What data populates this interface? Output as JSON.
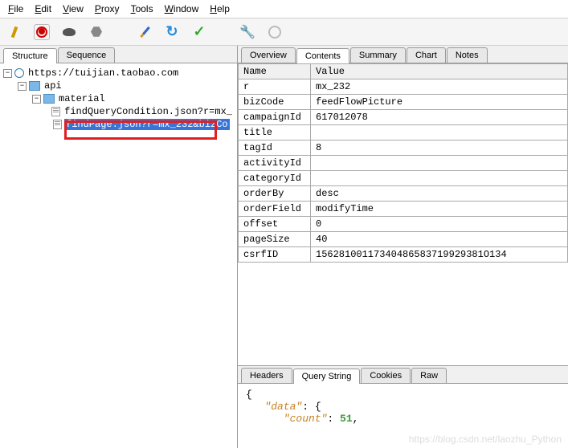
{
  "menu": {
    "file": "File",
    "edit": "Edit",
    "view": "View",
    "proxy": "Proxy",
    "tools": "Tools",
    "window": "Window",
    "help": "Help"
  },
  "left_tabs": {
    "structure": "Structure",
    "sequence": "Sequence"
  },
  "tree": {
    "root": "https://tuijian.taobao.com",
    "n1": "api",
    "n2": "material",
    "item1": "findQueryCondition.json?r=mx_",
    "item2": "findPage.json?r=mx_232&bizCo"
  },
  "right_tabs": {
    "overview": "Overview",
    "contents": "Contents",
    "summary": "Summary",
    "chart": "Chart",
    "notes": "Notes"
  },
  "table": {
    "h1": "Name",
    "h2": "Value",
    "rows": [
      {
        "k": "r",
        "v": "mx_232"
      },
      {
        "k": "bizCode",
        "v": "feedFlowPicture"
      },
      {
        "k": "campaignId",
        "v": "617012078"
      },
      {
        "k": "title",
        "v": ""
      },
      {
        "k": "tagId",
        "v": "8"
      },
      {
        "k": "activityId",
        "v": ""
      },
      {
        "k": "categoryId",
        "v": ""
      },
      {
        "k": "orderBy",
        "v": "desc"
      },
      {
        "k": "orderField",
        "v": "modifyTime"
      },
      {
        "k": "offset",
        "v": "0"
      },
      {
        "k": "pageSize",
        "v": "40"
      },
      {
        "k": "csrfID",
        "v": "15628100117340486583719929381O134"
      }
    ]
  },
  "sub_tabs": {
    "headers": "Headers",
    "query": "Query String",
    "cookies": "Cookies",
    "raw": "Raw"
  },
  "json": {
    "l1": "{",
    "l2_k": "\"data\"",
    "l2_s": ": {",
    "l3_k": "\"count\"",
    "l3_s": ": ",
    "l3_v": "51",
    "l3_e": ","
  },
  "watermark": "https://blog.csdn.net/laozhu_Python"
}
